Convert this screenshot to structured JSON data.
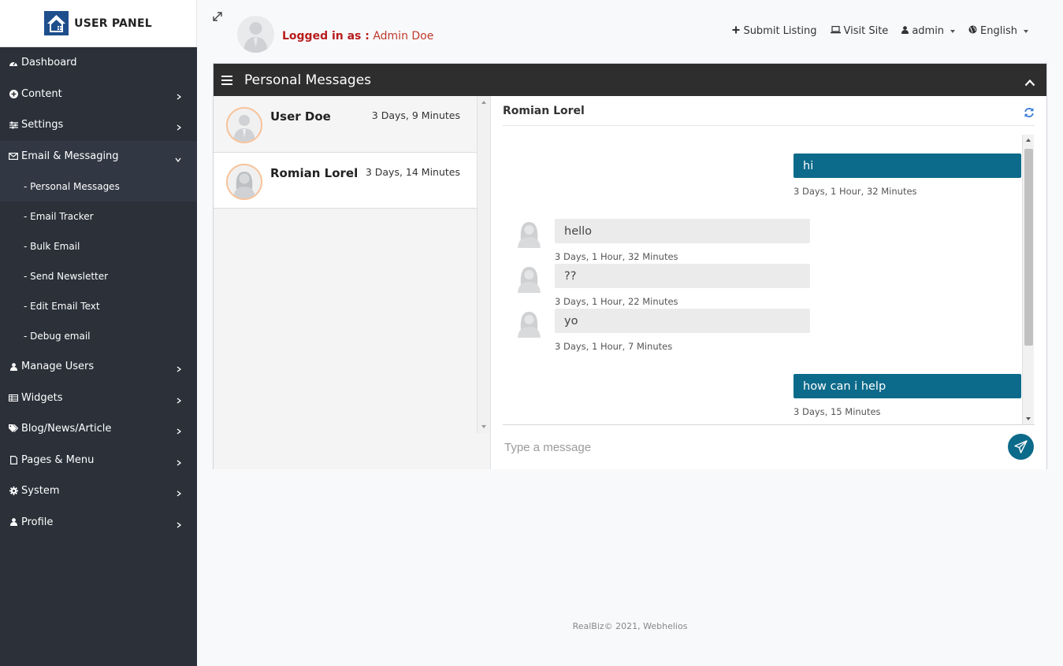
{
  "brand": {
    "title": "USER PANEL"
  },
  "sidebar": {
    "items": [
      {
        "label": "Dashboard",
        "icon": "dashboard-icon"
      },
      {
        "label": "Content",
        "icon": "plus-circle-icon"
      },
      {
        "label": "Settings",
        "icon": "sliders-icon"
      },
      {
        "label": "Email & Messaging",
        "icon": "envelope-icon"
      },
      {
        "label": "Manage Users",
        "icon": "user-icon"
      },
      {
        "label": "Widgets",
        "icon": "widgets-icon"
      },
      {
        "label": "Blog/News/Article",
        "icon": "tags-icon"
      },
      {
        "label": "Pages & Menu",
        "icon": "file-icon"
      },
      {
        "label": "System",
        "icon": "cog-icon"
      },
      {
        "label": "Profile",
        "icon": "user-icon"
      }
    ],
    "email_sub": [
      {
        "label": "- Personal Messages"
      },
      {
        "label": "- Email Tracker"
      },
      {
        "label": "- Bulk Email"
      },
      {
        "label": "- Send Newsletter"
      },
      {
        "label": "- Edit Email Text"
      },
      {
        "label": "- Debug email"
      }
    ]
  },
  "topbar": {
    "logged_prefix": "Logged in as :",
    "logged_user": "Admin Doe",
    "submit_listing": "Submit Listing",
    "visit_site": "Visit Site",
    "admin": "admin",
    "language": "English"
  },
  "card": {
    "title": "Personal Messages"
  },
  "contacts": [
    {
      "name": "User Doe",
      "time": "3 Days, 9 Minutes"
    },
    {
      "name": "Romian Lorel",
      "time": "3 Days, 14 Minutes"
    }
  ],
  "chat": {
    "name": "Romian Lorel",
    "messages": [
      {
        "dir": "out",
        "text": "hi",
        "time": "3 Days, 1 Hour, 32 Minutes"
      },
      {
        "dir": "in",
        "text": "hello",
        "time": "3 Days, 1 Hour, 32 Minutes"
      },
      {
        "dir": "in",
        "text": "??",
        "time": "3 Days, 1 Hour, 22 Minutes"
      },
      {
        "dir": "in",
        "text": "yo",
        "time": "3 Days, 1 Hour, 7 Minutes"
      },
      {
        "dir": "out",
        "text": "how can i help",
        "time": "3 Days, 15 Minutes"
      }
    ],
    "input_placeholder": "Type a message"
  },
  "footer": {
    "text": "RealBiz© 2021, Webhelios"
  },
  "colors": {
    "sidebar": "#2b3039",
    "accent": "#0c6a8a",
    "header": "#2e2e2e",
    "logged_in": "#b71c1c"
  }
}
